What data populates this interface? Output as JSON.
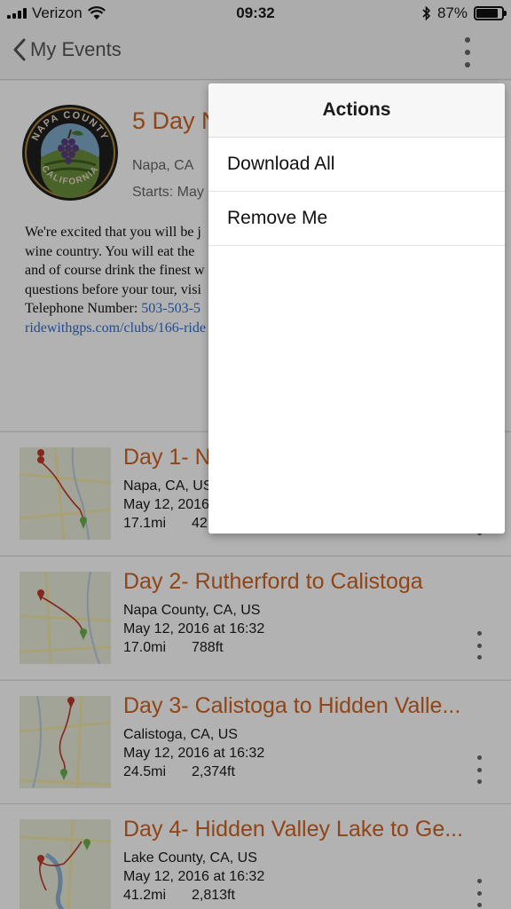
{
  "status_bar": {
    "carrier": "Verizon",
    "time": "09:32",
    "battery": "87%",
    "battery_level": 0.87
  },
  "nav": {
    "back_label": "My Events"
  },
  "event": {
    "title": "5 Day N",
    "location": "Napa, CA",
    "starts": "Starts: May",
    "seal": {
      "top_text": "NAPA COUNTY",
      "bottom_text": "CALIFORNIA"
    },
    "description": {
      "line1": "We're excited that you will be j",
      "line2": "wine country. You will eat the",
      "line3": "and of course drink the finest w",
      "line4": "questions before your tour, visi",
      "line5_label": "Telephone Number: ",
      "line5_phone": "503-503-5",
      "line6_link": "ridewithgps.com/clubs/166-ride"
    }
  },
  "routes": [
    {
      "title": "Day 1- N",
      "location": "Napa, CA, US",
      "date": "May 12, 2016",
      "distance": "17.1mi",
      "elevation": "42"
    },
    {
      "title": "Day 2- Rutherford to Calistoga",
      "location": "Napa County, CA, US",
      "date": "May 12, 2016 at 16:32",
      "distance": "17.0mi",
      "elevation": "788ft"
    },
    {
      "title": "Day 3- Calistoga to Hidden Valle...",
      "location": "Calistoga, CA, US",
      "date": "May 12, 2016 at 16:32",
      "distance": "24.5mi",
      "elevation": "2,374ft"
    },
    {
      "title": "Day 4- Hidden Valley Lake to Ge...",
      "location": "Lake County, CA, US",
      "date": "May 12, 2016 at 16:32",
      "distance": "41.2mi",
      "elevation": "2,813ft"
    }
  ],
  "actions": {
    "title": "Actions",
    "items": [
      "Download All",
      "Remove Me"
    ]
  },
  "colors": {
    "accent": "#d0621f",
    "link": "#2f6ccf",
    "overlay": "rgba(0,0,0,0.3)"
  },
  "icons": [
    "cellular-signal-icon",
    "wifi-icon",
    "bluetooth-icon",
    "battery-icon",
    "back-chevron-icon",
    "more-vertical-icon",
    "map-pin-icon"
  ]
}
